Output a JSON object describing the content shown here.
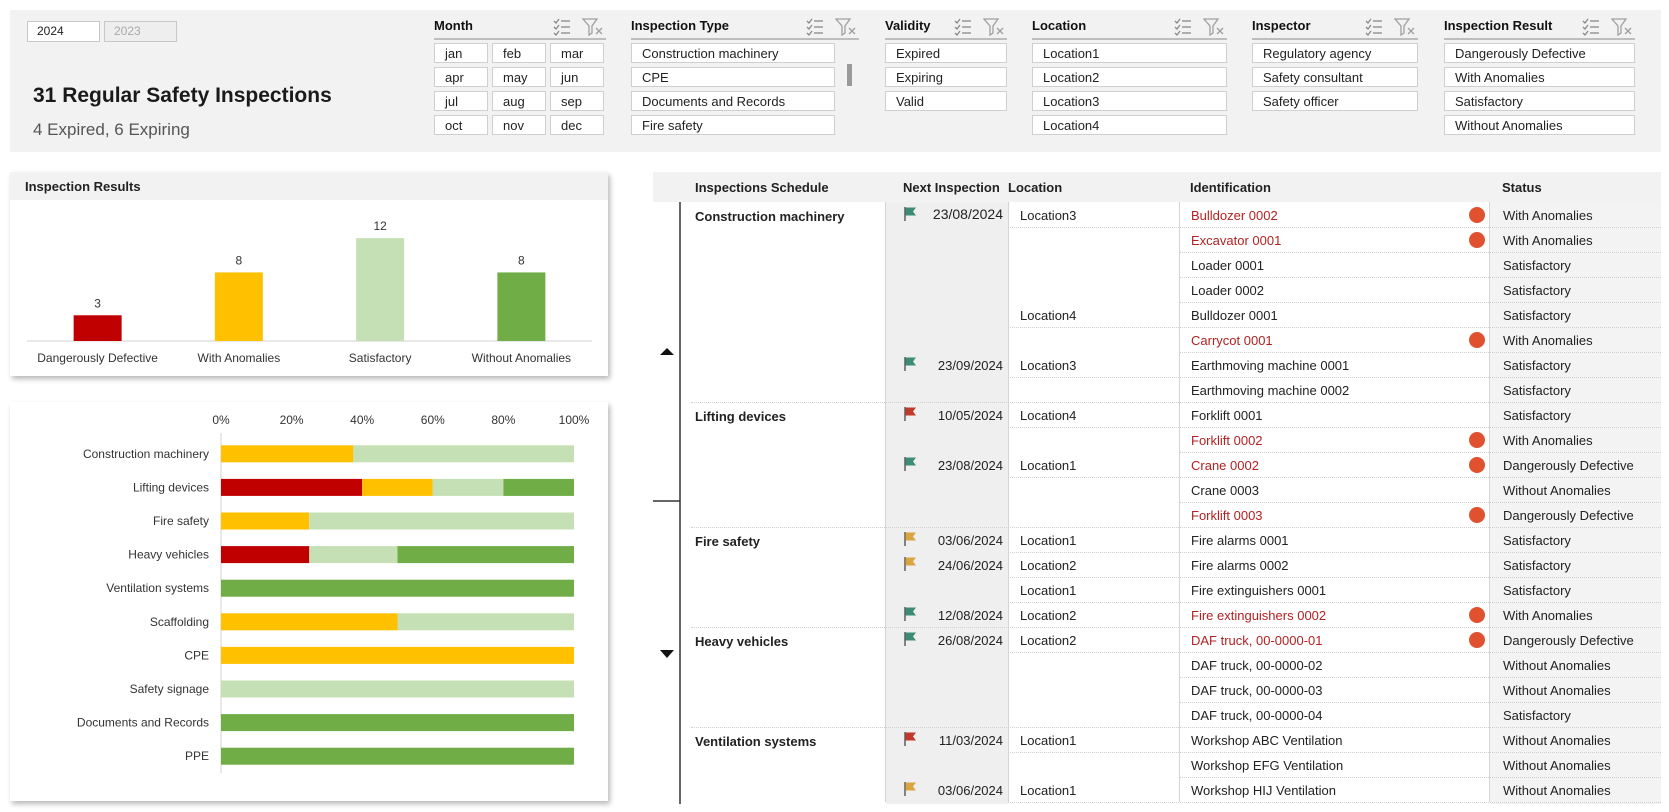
{
  "years": {
    "active": "2024",
    "inactive": "2023"
  },
  "kpi": {
    "title": "31 Regular Safety Inspections",
    "subtitle": "4 Expired, 6 Expiring"
  },
  "slicers": {
    "month": {
      "title": "Month",
      "items": [
        "jan",
        "feb",
        "mar",
        "apr",
        "may",
        "jun",
        "jul",
        "aug",
        "sep",
        "oct",
        "nov",
        "dec"
      ]
    },
    "inspection_type": {
      "title": "Inspection Type",
      "items": [
        "Construction machinery",
        "CPE",
        "Documents and Records",
        "Fire safety"
      ]
    },
    "validity": {
      "title": "Validity",
      "items": [
        "Expired",
        "Expiring",
        "Valid"
      ]
    },
    "location": {
      "title": "Location",
      "items": [
        "Location1",
        "Location2",
        "Location3",
        "Location4"
      ]
    },
    "inspector": {
      "title": "Inspector",
      "items": [
        "Regulatory agency",
        "Safety consultant",
        "Safety officer"
      ]
    },
    "inspection_result": {
      "title": "Inspection Result",
      "items": [
        "Dangerously Defective",
        "With Anomalies",
        "Satisfactory",
        "Without Anomalies"
      ]
    }
  },
  "results_panel": {
    "title": "Inspection Results"
  },
  "chart_data": [
    {
      "type": "bar",
      "title": "Inspection Results",
      "categories": [
        "Dangerously Defective",
        "With Anomalies",
        "Satisfactory",
        "Without Anomalies"
      ],
      "values": [
        3,
        8,
        12,
        8
      ],
      "colors": [
        "#c00000",
        "#ffc000",
        "#c5e0b4",
        "#70ad47"
      ]
    },
    {
      "type": "bar",
      "orientation": "horizontal",
      "stacked": "percent",
      "categories": [
        "Construction machinery",
        "Lifting devices",
        "Fire safety",
        "Heavy vehicles",
        "Ventilation systems",
        "Scaffolding",
        "CPE",
        "Safety signage",
        "Documents and Records",
        "PPE"
      ],
      "x_ticks": [
        "0%",
        "20%",
        "40%",
        "60%",
        "80%",
        "100%"
      ],
      "series": [
        {
          "color": "#c00000",
          "values": [
            0,
            40,
            0,
            25,
            0,
            0,
            0,
            0,
            0,
            0
          ]
        },
        {
          "color": "#ffc000",
          "values": [
            37.5,
            20,
            25,
            0,
            0,
            50,
            100,
            0,
            0,
            0
          ]
        },
        {
          "color": "#c5e0b4",
          "values": [
            62.5,
            20,
            75,
            25,
            0,
            50,
            0,
            100,
            0,
            0
          ]
        },
        {
          "color": "#70ad47",
          "values": [
            0,
            20,
            0,
            50,
            100,
            0,
            0,
            0,
            100,
            100
          ]
        }
      ]
    }
  ],
  "table": {
    "headers": {
      "schedule": "Inspections Schedule",
      "next": "Next Inspection",
      "location": "Location",
      "identification": "Identification",
      "status": "Status"
    },
    "groups": [
      {
        "name": "Construction machinery",
        "rows": 8
      },
      {
        "name": "Lifting devices",
        "rows": 5
      },
      {
        "name": "Fire safety",
        "rows": 4
      },
      {
        "name": "Heavy vehicles",
        "rows": 4
      },
      {
        "name": "Ventilation systems",
        "rows": 3
      }
    ],
    "rows": [
      {
        "date": "23/08/2024",
        "flag": "#3d8c75",
        "location": "Location3",
        "id": "Bulldozer 0002",
        "alert": true,
        "status": "With Anomalies"
      },
      {
        "date": "",
        "flag": "",
        "location": "",
        "id": "Excavator 0001",
        "alert": true,
        "status": "With Anomalies"
      },
      {
        "date": "",
        "flag": "",
        "location": "",
        "id": "Loader 0001",
        "alert": false,
        "status": "Satisfactory"
      },
      {
        "date": "",
        "flag": "",
        "location": "",
        "id": "Loader 0002",
        "alert": false,
        "status": "Satisfactory"
      },
      {
        "date": "",
        "flag": "",
        "location": "Location4",
        "id": "Bulldozer 0001",
        "alert": false,
        "status": "Satisfactory"
      },
      {
        "date": "",
        "flag": "",
        "location": "",
        "id": "Carrycot 0001",
        "alert": true,
        "status": "With Anomalies"
      },
      {
        "date": "23/09/2024",
        "flag": "#3d8c75",
        "location": "Location3",
        "id": "Earthmoving machine 0001",
        "alert": false,
        "status": "Satisfactory"
      },
      {
        "date": "",
        "flag": "",
        "location": "",
        "id": "Earthmoving machine 0002",
        "alert": false,
        "status": "Satisfactory"
      },
      {
        "date": "10/05/2024",
        "flag": "#c0392b",
        "location": "Location4",
        "id": "Forklift 0001",
        "alert": false,
        "status": "Satisfactory"
      },
      {
        "date": "",
        "flag": "",
        "location": "",
        "id": "Forklift 0002",
        "alert": true,
        "status": "With Anomalies"
      },
      {
        "date": "23/08/2024",
        "flag": "#3d8c75",
        "location": "Location1",
        "id": "Crane 0002",
        "alert": true,
        "status": "Dangerously Defective"
      },
      {
        "date": "",
        "flag": "",
        "location": "",
        "id": "Crane 0003",
        "alert": false,
        "status": "Without Anomalies"
      },
      {
        "date": "",
        "flag": "",
        "location": "",
        "id": "Forklift 0003",
        "alert": true,
        "status": "Dangerously Defective"
      },
      {
        "date": "03/06/2024",
        "flag": "#d9a441",
        "location": "Location1",
        "id": "Fire alarms 0001",
        "alert": false,
        "status": "Satisfactory"
      },
      {
        "date": "24/06/2024",
        "flag": "#d9a441",
        "location": "Location2",
        "id": "Fire alarms 0002",
        "alert": false,
        "status": "Satisfactory"
      },
      {
        "date": "",
        "flag": "",
        "location": "Location1",
        "id": "Fire extinguishers 0001",
        "alert": false,
        "status": "Satisfactory"
      },
      {
        "date": "12/08/2024",
        "flag": "#3d8c75",
        "location": "Location2",
        "id": "Fire extinguishers 0002",
        "alert": true,
        "status": "With Anomalies"
      },
      {
        "date": "26/08/2024",
        "flag": "#3d8c75",
        "location": "Location2",
        "id": "DAF truck, 00-0000-01",
        "alert": true,
        "status": "Dangerously Defective"
      },
      {
        "date": "",
        "flag": "",
        "location": "",
        "id": "DAF truck, 00-0000-02",
        "alert": false,
        "status": "Without Anomalies"
      },
      {
        "date": "",
        "flag": "",
        "location": "",
        "id": "DAF truck, 00-0000-03",
        "alert": false,
        "status": "Without Anomalies"
      },
      {
        "date": "",
        "flag": "",
        "location": "",
        "id": "DAF truck, 00-0000-04",
        "alert": false,
        "status": "Satisfactory"
      },
      {
        "date": "11/03/2024",
        "flag": "#c0392b",
        "location": "Location1",
        "id": "Workshop ABC Ventilation",
        "alert": false,
        "status": "Without Anomalies"
      },
      {
        "date": "",
        "flag": "",
        "location": "",
        "id": "Workshop EFG Ventilation",
        "alert": false,
        "status": "Without Anomalies"
      },
      {
        "date": "03/06/2024",
        "flag": "#d9a441",
        "location": "Location1",
        "id": "Workshop HIJ Ventilation",
        "alert": false,
        "status": "Without Anomalies"
      }
    ]
  }
}
